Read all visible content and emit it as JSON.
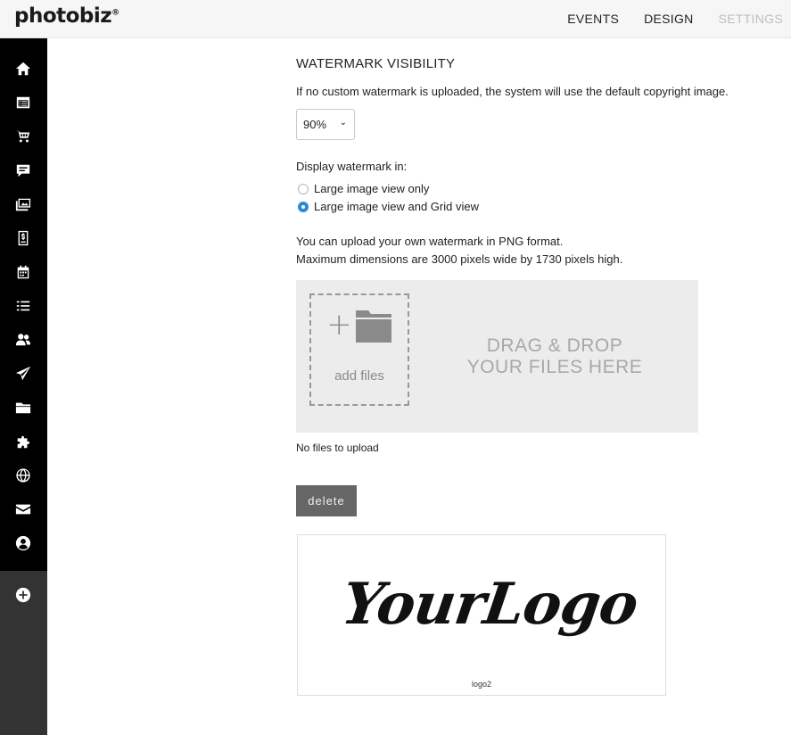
{
  "header": {
    "logo_text": "photobiz",
    "logo_mark": "®",
    "nav": [
      "EVENTS",
      "DESIGN",
      "SETTINGS"
    ]
  },
  "sidebar": {
    "icons": [
      "home-icon",
      "calendar-list-icon",
      "cart-icon",
      "chat-icon",
      "gallery-icon",
      "invoice-icon",
      "event-calendar-icon",
      "list-icon",
      "users-icon",
      "send-icon",
      "folder-icon",
      "puzzle-icon",
      "globe-icon",
      "mail-icon",
      "account-icon"
    ],
    "add_icon": "plus-circle-icon"
  },
  "watermark": {
    "title": "WATERMARK VISIBILITY",
    "description": "If no custom watermark is uploaded, the system will use the default copyright image.",
    "opacity_value": "90%",
    "display_label": "Display watermark in:",
    "options": [
      {
        "label": "Large image view only",
        "selected": false
      },
      {
        "label": "Large image view and Grid view",
        "selected": true
      }
    ],
    "upload_info_1": "You can upload your own watermark in PNG format.",
    "upload_info_2": "Maximum dimensions are 3000 pixels wide by 1730 pixels high.",
    "add_files_label": "add files",
    "drag_drop_line1": "DRAG & DROP",
    "drag_drop_line2": "YOUR FILES HERE",
    "no_files_text": "No files to upload",
    "delete_label": "delete",
    "preview_logo_text": "YourLogo",
    "preview_caption": "logo2"
  },
  "colors": {
    "sidebar": "#000000",
    "sidebar_bottom": "#333333",
    "radio_selected": "#2d8ad8",
    "delete_button": "#666666",
    "dropzone": "#ececec"
  }
}
